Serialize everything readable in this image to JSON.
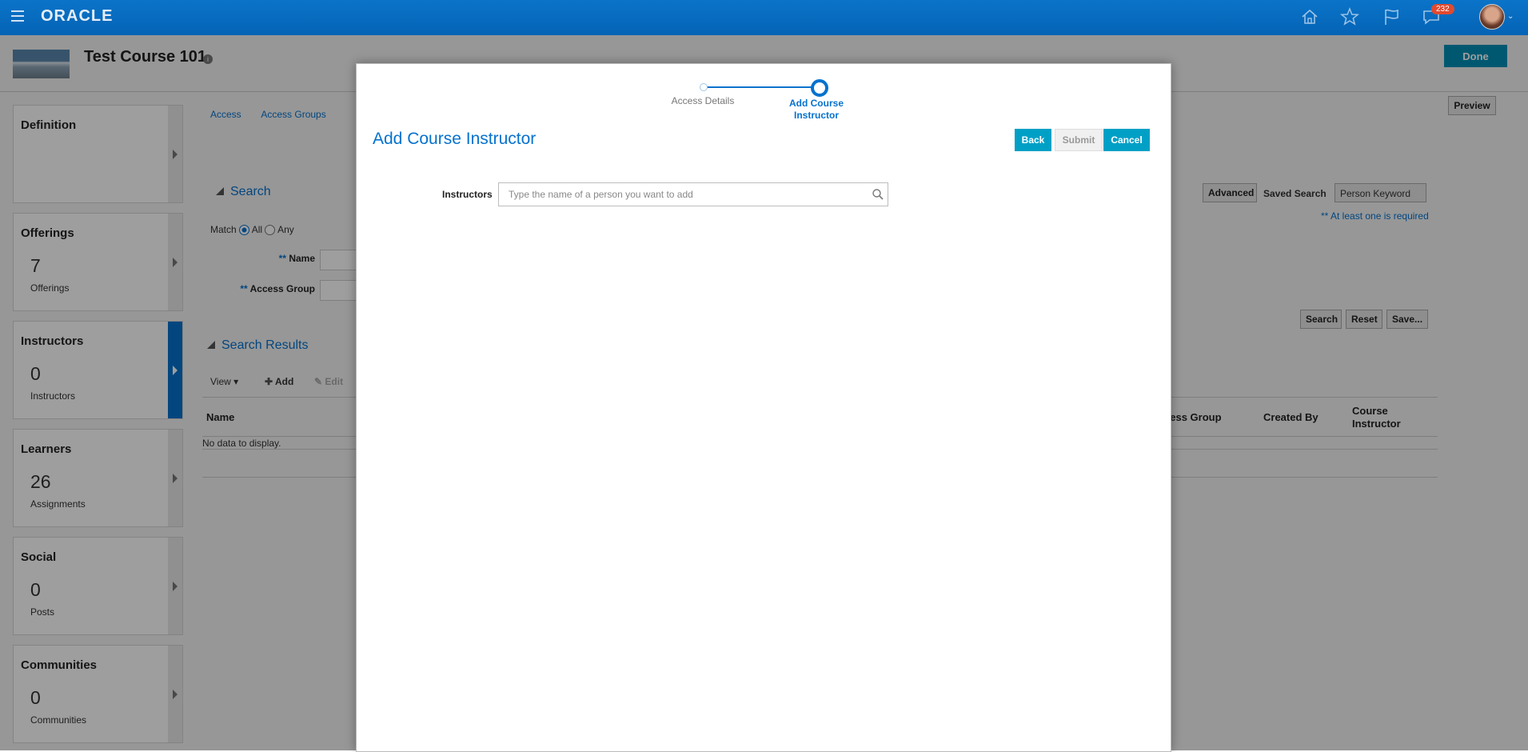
{
  "header": {
    "logo": "ORACLE",
    "notification_count": "232",
    "icons": [
      "menu-icon",
      "home-icon",
      "star-icon",
      "flag-icon",
      "notifications-icon"
    ]
  },
  "course": {
    "title": "Test Course 101",
    "info": "i",
    "done_label": "Done",
    "preview_label": "Preview"
  },
  "cards": [
    {
      "title": "Definition",
      "count": "",
      "sub": ""
    },
    {
      "title": "Offerings",
      "count": "7",
      "sub": "Offerings"
    },
    {
      "title": "Instructors",
      "count": "0",
      "sub": "Instructors"
    },
    {
      "title": "Learners",
      "count": "26",
      "sub": "Assignments"
    },
    {
      "title": "Social",
      "count": "0",
      "sub": "Posts"
    },
    {
      "title": "Communities",
      "count": "0",
      "sub": "Communities"
    }
  ],
  "subnav": {
    "access": "Access",
    "access_groups": "Access Groups"
  },
  "search": {
    "title": "Search",
    "match_label": "Match",
    "all_label": "All",
    "any_label": "Any",
    "req_marker": "**",
    "name_label": "Name",
    "access_group_label": "Access Group",
    "advanced_label": "Advanced",
    "saved_search_label": "Saved Search",
    "saved_search_value": "Person Keyword",
    "required_note": "** At least one is required",
    "search_btn": "Search",
    "reset_btn": "Reset",
    "save_btn": "Save..."
  },
  "results": {
    "title": "Search Results",
    "view_label": "View",
    "add_label": "Add",
    "edit_label": "Edit",
    "col_name": "Name",
    "col_access_group": "cess Group",
    "col_created_by": "Created By",
    "col_course_instructor_1": "Course",
    "col_course_instructor_2": "Instructor",
    "empty": "No data to display."
  },
  "modal": {
    "step1": "Access Details",
    "step2_line1": "Add Course",
    "step2_line2": "Instructor",
    "title": "Add Course Instructor",
    "back_label": "Back",
    "submit_label": "Submit",
    "cancel_label": "Cancel",
    "instructors_label": "Instructors",
    "instructors_placeholder": "Type the name of a person you want to add",
    "instructors_value": ""
  },
  "colors": {
    "brand": "#0572ce",
    "button_primary": "#00a0c6",
    "badge": "#e04a2f"
  }
}
